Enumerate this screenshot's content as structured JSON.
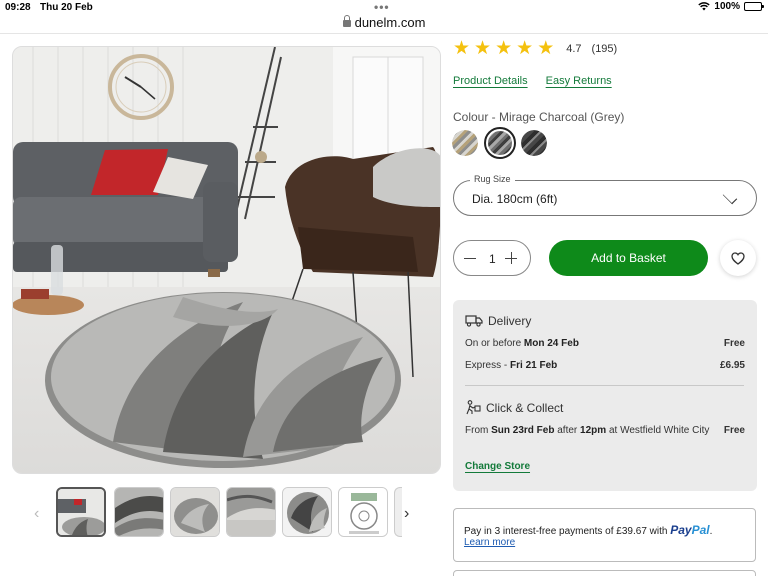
{
  "status_bar": {
    "time": "09:28",
    "date": "Thu 20 Feb",
    "battery": "100%",
    "menu_dots": "•••"
  },
  "browser": {
    "url": "dunelm.com"
  },
  "product": {
    "rating": {
      "stars": 5,
      "score": "4.7",
      "count": "(195)"
    },
    "links": {
      "details": "Product Details",
      "returns": "Easy Returns"
    },
    "colour_label": "Colour - Mirage Charcoal (Grey)",
    "swatches": [
      "yellow-grey",
      "charcoal-grey",
      "dark-grey"
    ],
    "rug_size": {
      "legend": "Rug Size",
      "value": "Dia. 180cm (6ft)"
    },
    "quantity": "1",
    "add_to_basket": "Add to Basket"
  },
  "delivery": {
    "title": "Delivery",
    "standard": {
      "prefix": "On or before ",
      "date": "Mon 24 Feb",
      "price": "Free"
    },
    "express": {
      "prefix": "Express - ",
      "date": "Fri 21 Feb",
      "price": "£6.95"
    },
    "click_collect": {
      "title": "Click & Collect",
      "from": "From ",
      "date": "Sun 23rd Feb",
      "after": " after ",
      "time": "12pm",
      "at": " at Westfield White City",
      "price": "Free",
      "change_store": "Change Store"
    }
  },
  "paypal": {
    "text": "Pay in 3 interest-free payments of £39.67 with ",
    "logo_pay": "Pay",
    "logo_pal": "Pal",
    "suffix": ".",
    "learn_more": "Learn more"
  },
  "colors": {
    "green_button": "#0e8a1a",
    "green_link": "#137a3a",
    "star": "#f4c10f",
    "panel_bg": "#ebebeb"
  }
}
